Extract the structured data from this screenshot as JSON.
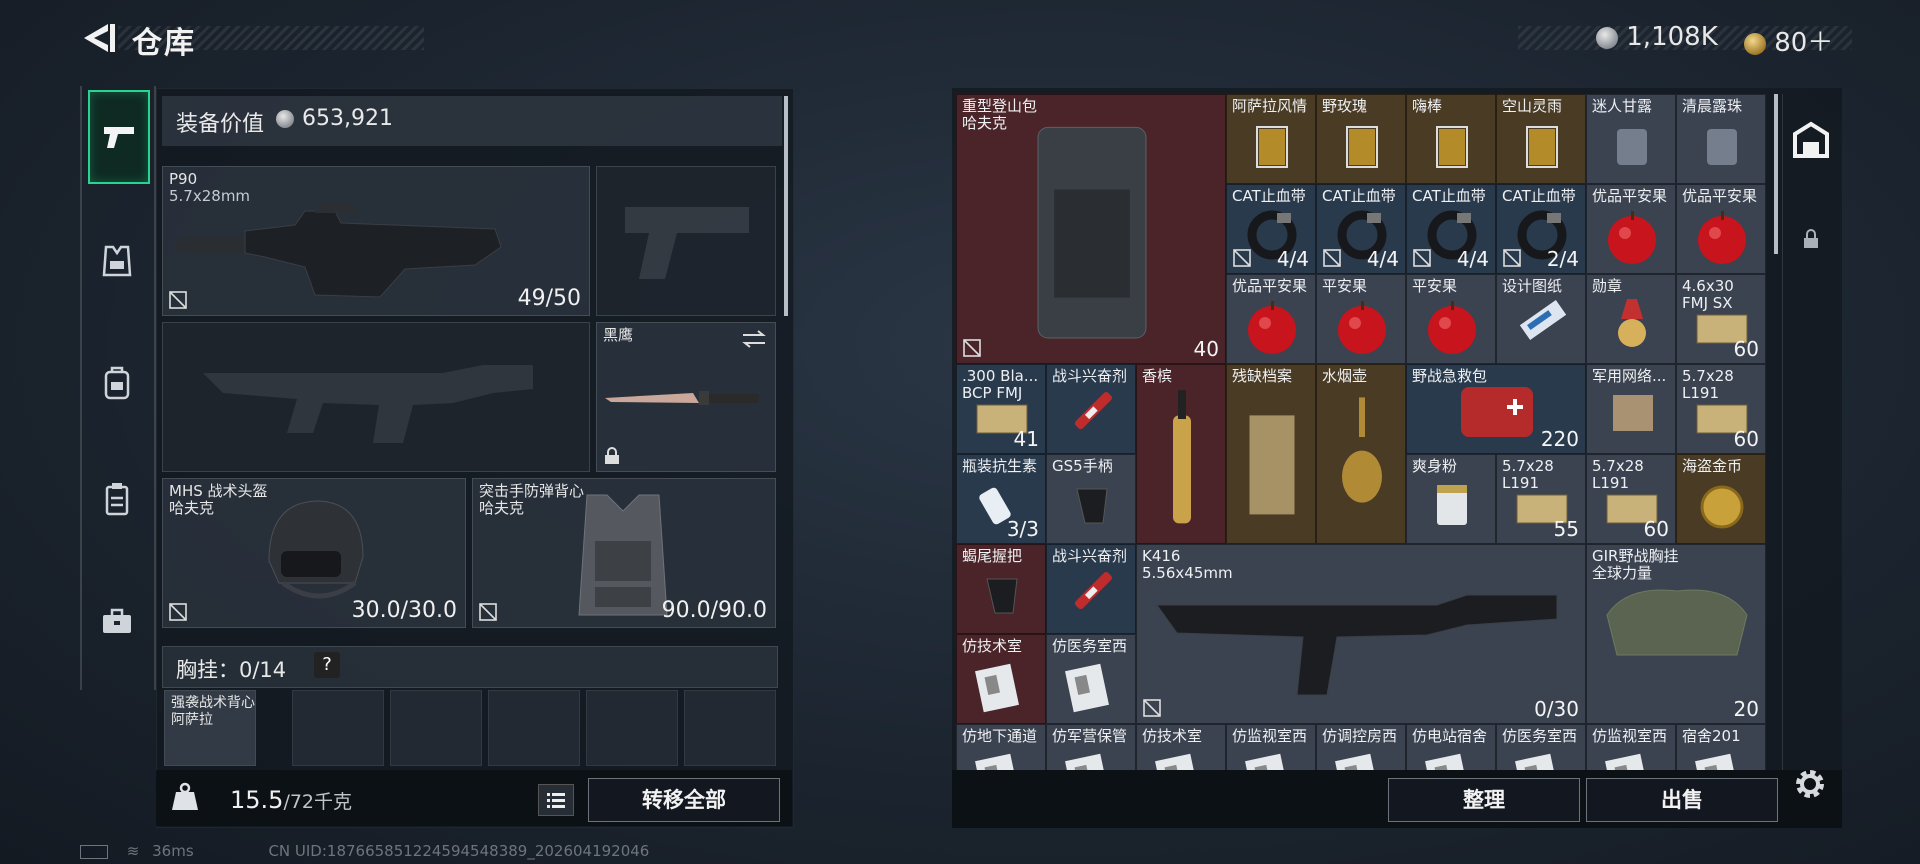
{
  "header": {
    "title": "仓库"
  },
  "currency": [
    {
      "icon": "silver-coin-icon",
      "value": "1,108K"
    },
    {
      "icon": "gold-coin-icon",
      "value": "80＋"
    }
  ],
  "nav": {
    "items": [
      {
        "icon": "pistol-icon",
        "active": true
      },
      {
        "icon": "vest-icon",
        "active": false
      },
      {
        "icon": "backpack-icon",
        "active": false
      },
      {
        "icon": "chest-rig-icon",
        "active": false
      },
      {
        "icon": "toolbox-icon",
        "active": false
      }
    ]
  },
  "equipment": {
    "value_label": "装备价值",
    "value": "653,921",
    "primary": {
      "name": "P90",
      "sub": "5.7x28mm",
      "ammo": "49/50"
    },
    "knife": {
      "name": "黑鹰"
    },
    "helmet": {
      "name": "MHS 战术头盔",
      "sub": "哈夫克",
      "durability": "30.0/30.0"
    },
    "armor": {
      "name": "突击手防弹背心",
      "sub": "哈夫克",
      "durability": "90.0/90.0"
    },
    "chest_label": "胸挂：0/14",
    "chest_help": "?",
    "chest_first": {
      "name": "强袭战术背心",
      "sub": "阿萨拉"
    }
  },
  "bottom_left": {
    "weight": "15.5",
    "weight_max": "/72千克",
    "transfer_all": "转移全部"
  },
  "bottom_right": {
    "sort": "整理",
    "sell": "出售"
  },
  "backpack_items": [
    {
      "name": "重型登山包",
      "sub": "哈夫克",
      "count": "40",
      "icon": "backpack-icon"
    },
    {
      "name": "阿萨拉风情",
      "icon": "drink-icon"
    },
    {
      "name": "野玫瑰",
      "icon": "drink-icon"
    },
    {
      "name": "嗨棒",
      "icon": "drink-icon"
    },
    {
      "name": "空山灵雨",
      "icon": "drink-icon"
    },
    {
      "name": "迷人甘露",
      "icon": "glass-icon"
    },
    {
      "name": "清晨露珠",
      "icon": "glass-icon"
    },
    {
      "name": "CAT止血带",
      "count": "4/4",
      "icon": "tourniquet-icon"
    },
    {
      "name": "CAT止血带",
      "count": "4/4",
      "icon": "tourniquet-icon"
    },
    {
      "name": "CAT止血带",
      "count": "4/4",
      "icon": "tourniquet-icon"
    },
    {
      "name": "CAT止血带",
      "count": "2/4",
      "icon": "tourniquet-icon"
    },
    {
      "name": "优品平安果",
      "icon": "apple-icon"
    },
    {
      "name": "优品平安果",
      "icon": "apple-icon"
    },
    {
      "name": "优品平安果",
      "icon": "apple-icon"
    },
    {
      "name": "平安果",
      "icon": "apple-icon"
    },
    {
      "name": "平安果",
      "icon": "apple-icon"
    },
    {
      "name": "设计图纸",
      "icon": "blueprint-icon"
    },
    {
      "name": "勋章",
      "icon": "medal-icon"
    },
    {
      "name": "4.6x30",
      "sub": "FMJ SX",
      "count": "60",
      "icon": "ammo-box-icon"
    },
    {
      "name": ".300 Bla...",
      "sub": "BCP FMJ",
      "count": "41",
      "icon": "ammo-box-icon"
    },
    {
      "name": "战斗兴奋剂",
      "icon": "syringe-icon"
    },
    {
      "name": "香槟",
      "icon": "champagne-icon"
    },
    {
      "name": "残缺档案",
      "icon": "document-icon"
    },
    {
      "name": "水烟壶",
      "icon": "hookah-icon"
    },
    {
      "name": "野战急救包",
      "count": "220",
      "icon": "first-aid-kit-icon"
    },
    {
      "name": "军用网络...",
      "icon": "circuit-icon"
    },
    {
      "name": "5.7x28",
      "sub": "L191",
      "count": "60",
      "icon": "ammo-box-icon"
    },
    {
      "name": "瓶装抗生素",
      "count": "3/3",
      "icon": "pill-bottle-icon"
    },
    {
      "name": "GS5手柄",
      "icon": "grip-icon"
    },
    {
      "name": "爽身粉",
      "icon": "powder-can-icon"
    },
    {
      "name": "5.7x28",
      "sub": "L191",
      "count": "55",
      "icon": "ammo-box-icon"
    },
    {
      "name": "5.7x28",
      "sub": "L191",
      "count": "60",
      "icon": "ammo-box-icon"
    },
    {
      "name": "海盗金币",
      "icon": "gold-coin-icon"
    },
    {
      "name": "蝎尾握把",
      "icon": "grip-icon"
    },
    {
      "name": "战斗兴奋剂",
      "icon": "syringe-icon"
    },
    {
      "name": "K416",
      "sub": "5.56x45mm",
      "count": "0/30",
      "icon": "rifle-icon"
    },
    {
      "name": "GIR野战胸挂",
      "sub": "全球力量",
      "count": "20",
      "icon": "chest-rig-icon"
    },
    {
      "name": "仿技术室",
      "icon": "keycard-icon"
    },
    {
      "name": "仿医务室西",
      "icon": "keycard-icon"
    },
    {
      "name": "仿地下通道",
      "icon": "keycard-icon"
    },
    {
      "name": "仿军营保管",
      "icon": "keycard-icon"
    },
    {
      "name": "仿技术室",
      "icon": "keycard-icon"
    },
    {
      "name": "仿监视室西",
      "icon": "keycard-icon"
    },
    {
      "name": "仿调控房西",
      "icon": "keycard-icon"
    },
    {
      "name": "仿电站宿舍",
      "icon": "keycard-icon"
    },
    {
      "name": "仿医务室西",
      "icon": "keycard-icon"
    },
    {
      "name": "仿监视室西",
      "icon": "keycard-icon"
    },
    {
      "name": "宿舍201",
      "icon": "keycard-icon"
    }
  ],
  "status": {
    "ping": "36ms",
    "uid": "CN UID:187665851224594548389_202604192046"
  }
}
